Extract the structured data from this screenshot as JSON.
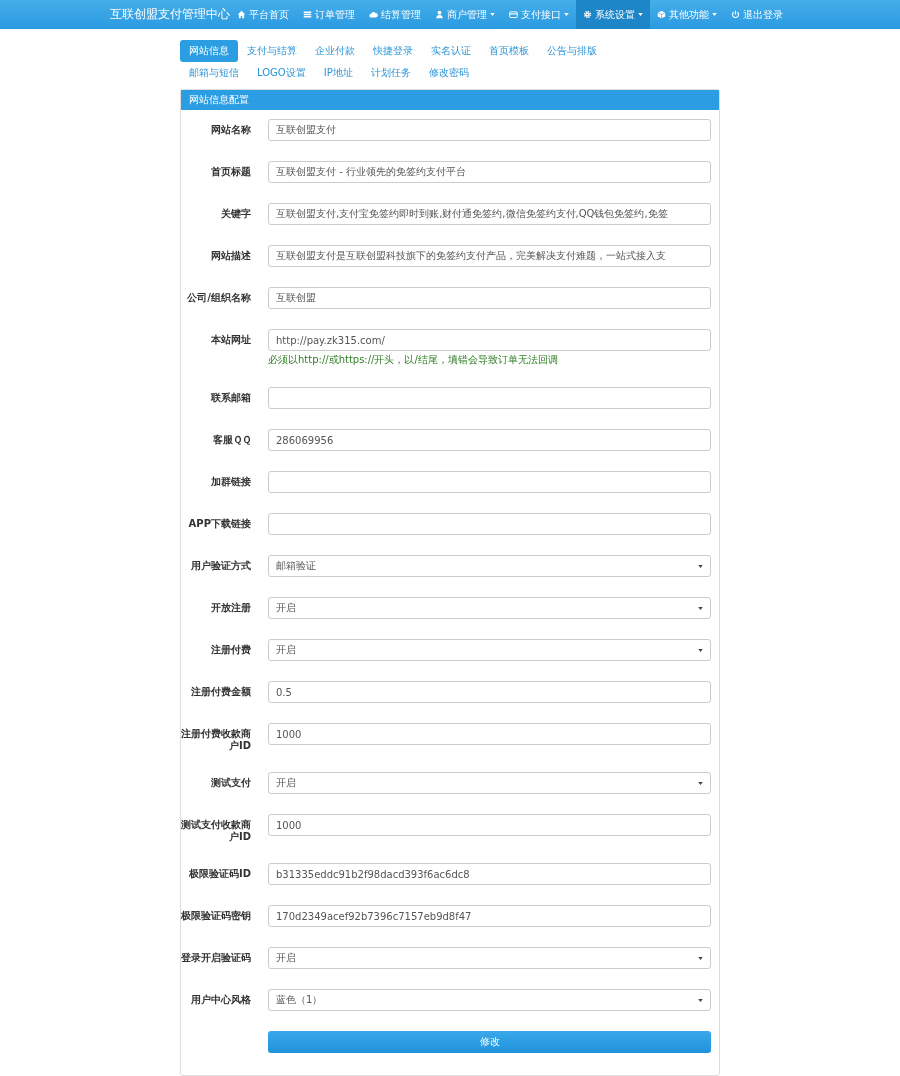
{
  "navbar": {
    "brand": "互联创盟支付管理中心",
    "items": [
      {
        "label": "平台首页",
        "dropdown": false,
        "selected": false
      },
      {
        "label": "订单管理",
        "dropdown": false,
        "selected": false
      },
      {
        "label": "结算管理",
        "dropdown": false,
        "selected": false
      },
      {
        "label": "商户管理",
        "dropdown": true,
        "selected": false
      },
      {
        "label": "支付接口",
        "dropdown": true,
        "selected": false
      },
      {
        "label": "系统设置",
        "dropdown": true,
        "selected": true
      },
      {
        "label": "其他功能",
        "dropdown": true,
        "selected": false
      },
      {
        "label": "退出登录",
        "dropdown": false,
        "selected": false
      }
    ]
  },
  "tabs": [
    {
      "label": "网站信息",
      "selected": true
    },
    {
      "label": "支付与结算",
      "selected": false
    },
    {
      "label": "企业付款",
      "selected": false
    },
    {
      "label": "快捷登录",
      "selected": false
    },
    {
      "label": "实名认证",
      "selected": false
    },
    {
      "label": "首页模板",
      "selected": false
    },
    {
      "label": "公告与排版",
      "selected": false
    },
    {
      "label": "邮箱与短信",
      "selected": false
    },
    {
      "label": "LOGO设置",
      "selected": false
    },
    {
      "label": "IP地址",
      "selected": false
    },
    {
      "label": "计划任务",
      "selected": false
    },
    {
      "label": "修改密码",
      "selected": false
    }
  ],
  "panel": {
    "heading": "网站信息配置",
    "fields": [
      {
        "label": "网站名称",
        "kind": "input",
        "value": "互联创盟支付"
      },
      {
        "label": "首页标题",
        "kind": "input",
        "value": "互联创盟支付 - 行业领先的免签约支付平台"
      },
      {
        "label": "关键字",
        "kind": "input",
        "value": "互联创盟支付,支付宝免签约即时到账,财付通免签约,微信免签约支付,QQ钱包免签约,免签"
      },
      {
        "label": "网站描述",
        "kind": "input",
        "value": "互联创盟支付是互联创盟科技旗下的免签约支付产品，完美解决支付难题，一站式接入支"
      },
      {
        "label": "公司/组织名称",
        "kind": "input",
        "value": "互联创盟"
      },
      {
        "label": "本站网址",
        "kind": "input",
        "value": "http://pay.zk315.com/",
        "hint": "必须以http://或https://开头，以/结尾，填错会导致订单无法回调"
      },
      {
        "label": "联系邮箱",
        "kind": "input"
      },
      {
        "label": "客服ＱＱ",
        "kind": "input",
        "value": "286069956"
      },
      {
        "label": "加群链接",
        "kind": "input"
      },
      {
        "label": "APP下载链接",
        "kind": "input"
      },
      {
        "label": "用户验证方式",
        "kind": "select",
        "value": "邮箱验证"
      },
      {
        "label": "开放注册",
        "kind": "select",
        "value": "开启"
      },
      {
        "label": "注册付费",
        "kind": "select",
        "value": "开启"
      },
      {
        "label": "注册付费金额",
        "kind": "input",
        "value": "0.5"
      },
      {
        "label": "注册付费收款商户ID",
        "kind": "input",
        "value": "1000"
      },
      {
        "label": "测试支付",
        "kind": "select",
        "value": "开启"
      },
      {
        "label": "测试支付收款商户ID",
        "kind": "input",
        "value": "1000"
      },
      {
        "label": "极限验证码ID",
        "kind": "input",
        "value": "b31335eddc91b2f98dacd393f6ac6dc8"
      },
      {
        "label": "极限验证码密钥",
        "kind": "input",
        "value": "170d2349acef92b7396c7157eb9d8f47"
      },
      {
        "label": "登录开启验证码",
        "kind": "select",
        "value": "开启"
      },
      {
        "label": "用户中心风格",
        "kind": "select",
        "value": "蓝色（1）"
      }
    ],
    "submit_button": "修改"
  }
}
